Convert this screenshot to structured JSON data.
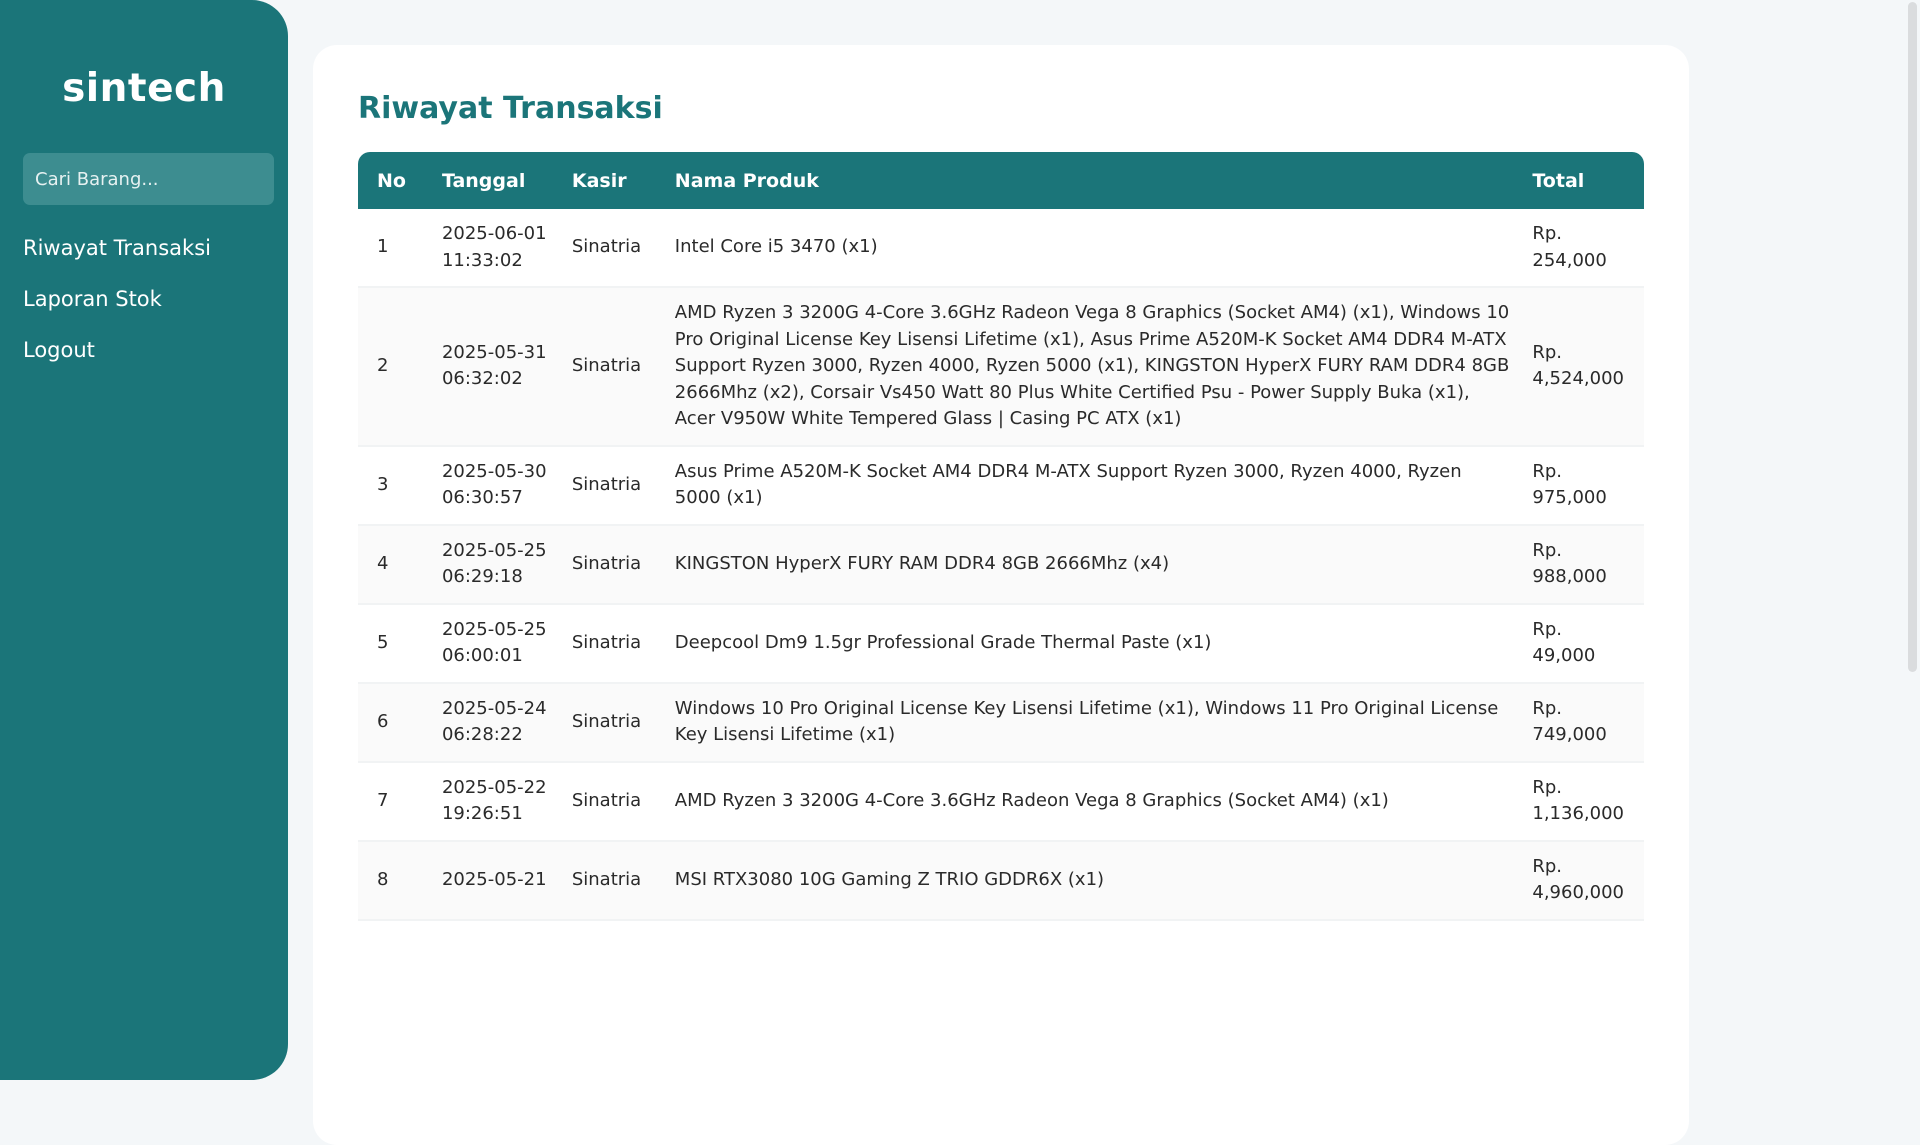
{
  "sidebar": {
    "brand": "sintech",
    "search_placeholder": "Cari Barang...",
    "nav": [
      {
        "label": "Riwayat Transaksi"
      },
      {
        "label": "Laporan Stok"
      },
      {
        "label": "Logout"
      }
    ]
  },
  "main": {
    "title": "Riwayat Transaksi",
    "table": {
      "headers": [
        "No",
        "Tanggal",
        "Kasir",
        "Nama Produk",
        "Total"
      ],
      "rows": [
        {
          "no": "1",
          "tanggal": "2025-06-01 11:33:02",
          "kasir": "Sinatria",
          "produk": "Intel Core i5 3470 (x1)",
          "total": "Rp. 254,000"
        },
        {
          "no": "2",
          "tanggal": "2025-05-31 06:32:02",
          "kasir": "Sinatria",
          "produk": "AMD Ryzen 3 3200G 4-Core 3.6GHz Radeon Vega 8 Graphics (Socket AM4) (x1), Windows 10 Pro Original License Key Lisensi Lifetime (x1), Asus Prime A520M-K Socket AM4 DDR4 M-ATX Support Ryzen 3000, Ryzen 4000, Ryzen 5000 (x1), KINGSTON HyperX FURY RAM DDR4 8GB 2666Mhz (x2), Corsair Vs450 Watt 80 Plus White Certified Psu - Power Supply Buka (x1), Acer V950W White Tempered Glass | Casing PC ATX (x1)",
          "total": "Rp. 4,524,000"
        },
        {
          "no": "3",
          "tanggal": "2025-05-30 06:30:57",
          "kasir": "Sinatria",
          "produk": "Asus Prime A520M-K Socket AM4 DDR4 M-ATX Support Ryzen 3000, Ryzen 4000, Ryzen 5000 (x1)",
          "total": "Rp. 975,000"
        },
        {
          "no": "4",
          "tanggal": "2025-05-25 06:29:18",
          "kasir": "Sinatria",
          "produk": "KINGSTON HyperX FURY RAM DDR4 8GB 2666Mhz (x4)",
          "total": "Rp. 988,000"
        },
        {
          "no": "5",
          "tanggal": "2025-05-25 06:00:01",
          "kasir": "Sinatria",
          "produk": "Deepcool Dm9 1.5gr Professional Grade Thermal Paste (x1)",
          "total": "Rp. 49,000"
        },
        {
          "no": "6",
          "tanggal": "2025-05-24 06:28:22",
          "kasir": "Sinatria",
          "produk": "Windows 10 Pro Original License Key Lisensi Lifetime (x1), Windows 11 Pro Original License Key Lisensi Lifetime (x1)",
          "total": "Rp. 749,000"
        },
        {
          "no": "7",
          "tanggal": "2025-05-22 19:26:51",
          "kasir": "Sinatria",
          "produk": "AMD Ryzen 3 3200G 4-Core 3.6GHz Radeon Vega 8 Graphics (Socket AM4) (x1)",
          "total": "Rp. 1,136,000"
        },
        {
          "no": "8",
          "tanggal": "2025-05-21",
          "kasir": "Sinatria",
          "produk": "MSI RTX3080 10G Gaming Z TRIO GDDR6X (x1)",
          "total": "Rp. 4,960,000"
        }
      ]
    }
  },
  "colors": {
    "primary": "#1b7579",
    "search_bg": "#3d8d90",
    "page_bg": "#f4f7f9",
    "card_bg": "#ffffff"
  }
}
